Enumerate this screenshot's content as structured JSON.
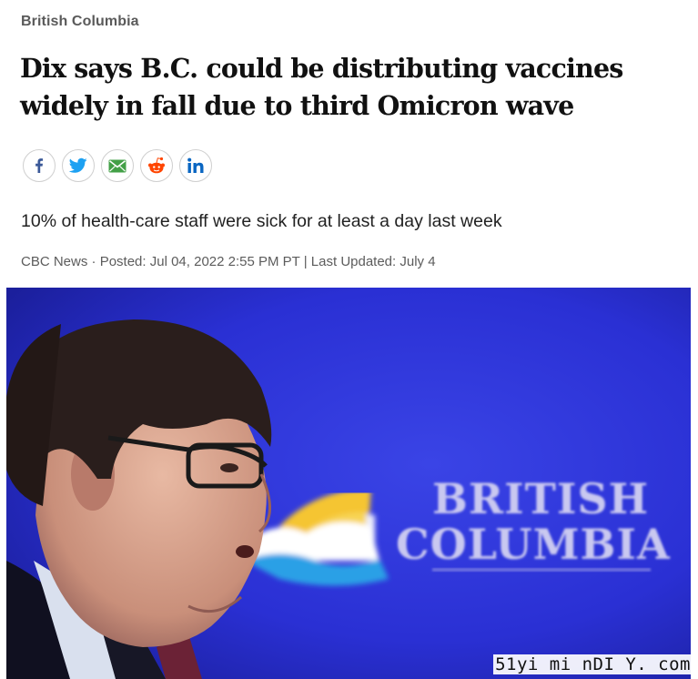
{
  "section": {
    "label": "British Columbia"
  },
  "article": {
    "headline": "Dix says B.C. could be distributing vaccines widely in fall due to third Omicron wave",
    "deck": "10% of health-care staff were sick for at least a day last week",
    "byline": {
      "source": "CBC News",
      "separator1": " · ",
      "posted": "Posted: Jul 04, 2022 2:55 PM PT",
      "separator2": " | ",
      "updated": "Last Updated: July 4"
    }
  },
  "share": {
    "icons": [
      "facebook-icon",
      "twitter-icon",
      "email-icon",
      "reddit-icon",
      "linkedin-icon"
    ],
    "colors": {
      "facebook": "#3b5998",
      "twitter": "#1da1f2",
      "email": "#43a047",
      "reddit": "#ff4500",
      "linkedin": "#0a66c2"
    }
  },
  "photo": {
    "backdrop_text_line1": "BRITISH",
    "backdrop_text_line2": "COLUMBIA",
    "background_color": "#2a2fd8"
  },
  "watermark": {
    "text": "51yi mi nDI Y. com"
  }
}
